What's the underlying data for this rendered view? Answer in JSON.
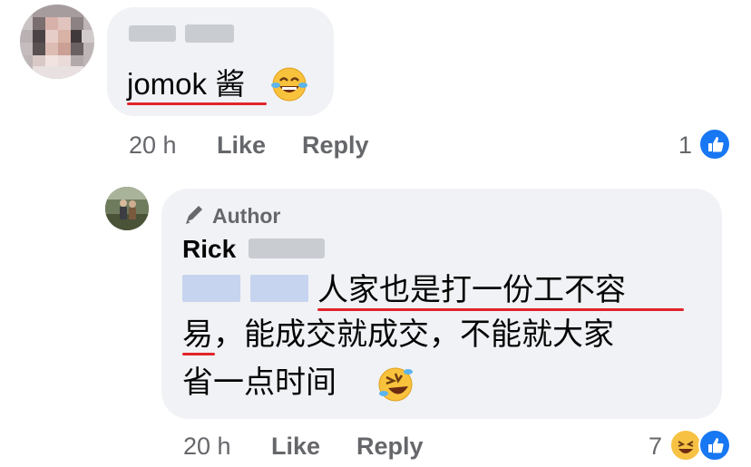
{
  "comment1": {
    "text": "jomok 酱",
    "time": "20 h",
    "like_label": "Like",
    "reply_label": "Reply",
    "reaction_count": "1"
  },
  "comment2": {
    "badge": "Author",
    "author_name": "Rick",
    "line1": "人家也是打一份工不容",
    "line2": "易，能成交就成交，不能就大家",
    "line3": "省一点时间",
    "time": "20 h",
    "like_label": "Like",
    "reply_label": "Reply",
    "reaction_count": "7"
  },
  "colors": {
    "bubble": "#f0f2f5",
    "underline": "#e2242c",
    "like_blue": "#1877f2",
    "meta_gray": "#65676b"
  },
  "icons": [
    "laughing-tears-emoji-icon",
    "pencil-icon",
    "rolling-laughing-emoji-icon",
    "like-reaction-icon",
    "haha-reaction-icon"
  ]
}
